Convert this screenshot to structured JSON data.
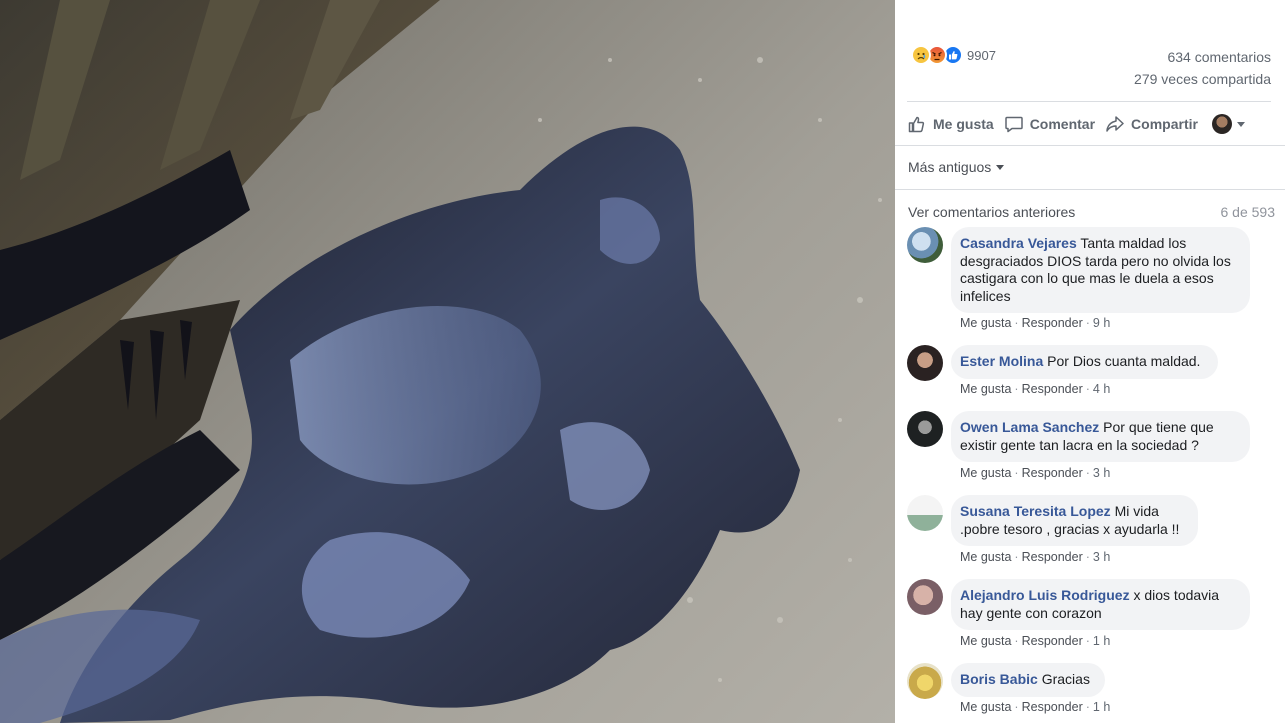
{
  "stats": {
    "reaction_icons": [
      "sad-reaction-icon",
      "angry-reaction-icon",
      "like-reaction-icon"
    ],
    "reaction_count": "9907",
    "comments": "634 comentarios",
    "shares": "279 veces compartida"
  },
  "actions": {
    "like": "Me gusta",
    "comment": "Comentar",
    "share": "Compartir"
  },
  "sort": {
    "label": "Más antiguos"
  },
  "previous": {
    "link": "Ver comentarios anteriores",
    "count": "6 de 593"
  },
  "comment_actions": {
    "like": "Me gusta",
    "reply": "Responder"
  },
  "comments": [
    {
      "author": "Casandra Vejares",
      "text": "Tanta maldad los desgraciados DIOS tarda pero no olvida los castigara con lo que mas le duela a esos infelices",
      "time": "9 h"
    },
    {
      "author": "Ester Molina",
      "text": "Por Dios cuanta maldad.",
      "time": "4 h"
    },
    {
      "author": "Owen Lama Sanchez",
      "text": "Por que tiene que existir gente tan lacra en la sociedad ?",
      "time": "3 h"
    },
    {
      "author": "Susana Teresita Lopez",
      "text": "Mi vida .pobre tesoro , gracias x ayudarla !!",
      "time": "3 h"
    },
    {
      "author": "Alejandro Luis Rodriguez",
      "text": "x dios todavia hay gente con corazon",
      "time": "1 h"
    },
    {
      "author": "Boris Babic",
      "text": "Gracias",
      "time": "1 h"
    }
  ],
  "colors": {
    "link": "#385898",
    "bubble": "#f2f3f5",
    "like_blue": "#1877f2"
  }
}
